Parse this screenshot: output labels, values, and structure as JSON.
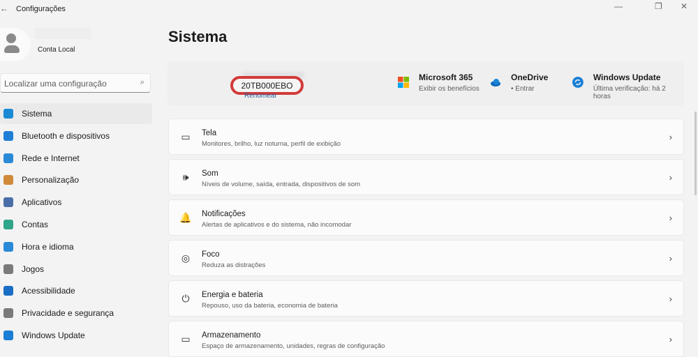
{
  "window": {
    "title": "Configurações"
  },
  "account": {
    "name": "Conta Local"
  },
  "search": {
    "placeholder": "Localizar uma configuração"
  },
  "nav": [
    {
      "label": "Sistema",
      "color": "#1a8ad4"
    },
    {
      "label": "Bluetooth e dispositivos",
      "color": "#1f7fd6"
    },
    {
      "label": "Rede e Internet",
      "color": "#2a8ad8"
    },
    {
      "label": "Personalização",
      "color": "#d08a3a"
    },
    {
      "label": "Aplicativos",
      "color": "#4a6fa8"
    },
    {
      "label": "Contas",
      "color": "#2fa58a"
    },
    {
      "label": "Hora e idioma",
      "color": "#2a8ad8"
    },
    {
      "label": "Jogos",
      "color": "#7a7a7a"
    },
    {
      "label": "Acessibilidade",
      "color": "#1a6fc4"
    },
    {
      "label": "Privacidade e segurança",
      "color": "#7a7a7a"
    },
    {
      "label": "Windows Update",
      "color": "#1a7fd4"
    }
  ],
  "page": {
    "title": "Sistema"
  },
  "device": {
    "name": "20TB000EBO",
    "rename": "Renomear"
  },
  "services": [
    {
      "name": "Microsoft 365",
      "sub": "Exibir os benefícios"
    },
    {
      "name": "OneDrive",
      "sub": "• Entrar"
    },
    {
      "name": "Windows Update",
      "sub": "Última verificação: há 2 horas"
    }
  ],
  "cards": [
    {
      "name": "Tela",
      "sub": "Monitores, brilho, luz noturna, perfil de exibição",
      "icon": "▭"
    },
    {
      "name": "Som",
      "sub": "Níveis de volume, saída, entrada, dispositivos de som",
      "icon": "🕪"
    },
    {
      "name": "Notificações",
      "sub": "Alertas de aplicativos e do sistema, não incomodar",
      "icon": "🔔"
    },
    {
      "name": "Foco",
      "sub": "Reduza as distrações",
      "icon": "◎"
    },
    {
      "name": "Energia e bateria",
      "sub": "Repouso, uso da bateria, economia de bateria",
      "icon": "⏻"
    },
    {
      "name": "Armazenamento",
      "sub": "Espaço de armazenamento, unidades, regras de configuração",
      "icon": "▭"
    }
  ]
}
